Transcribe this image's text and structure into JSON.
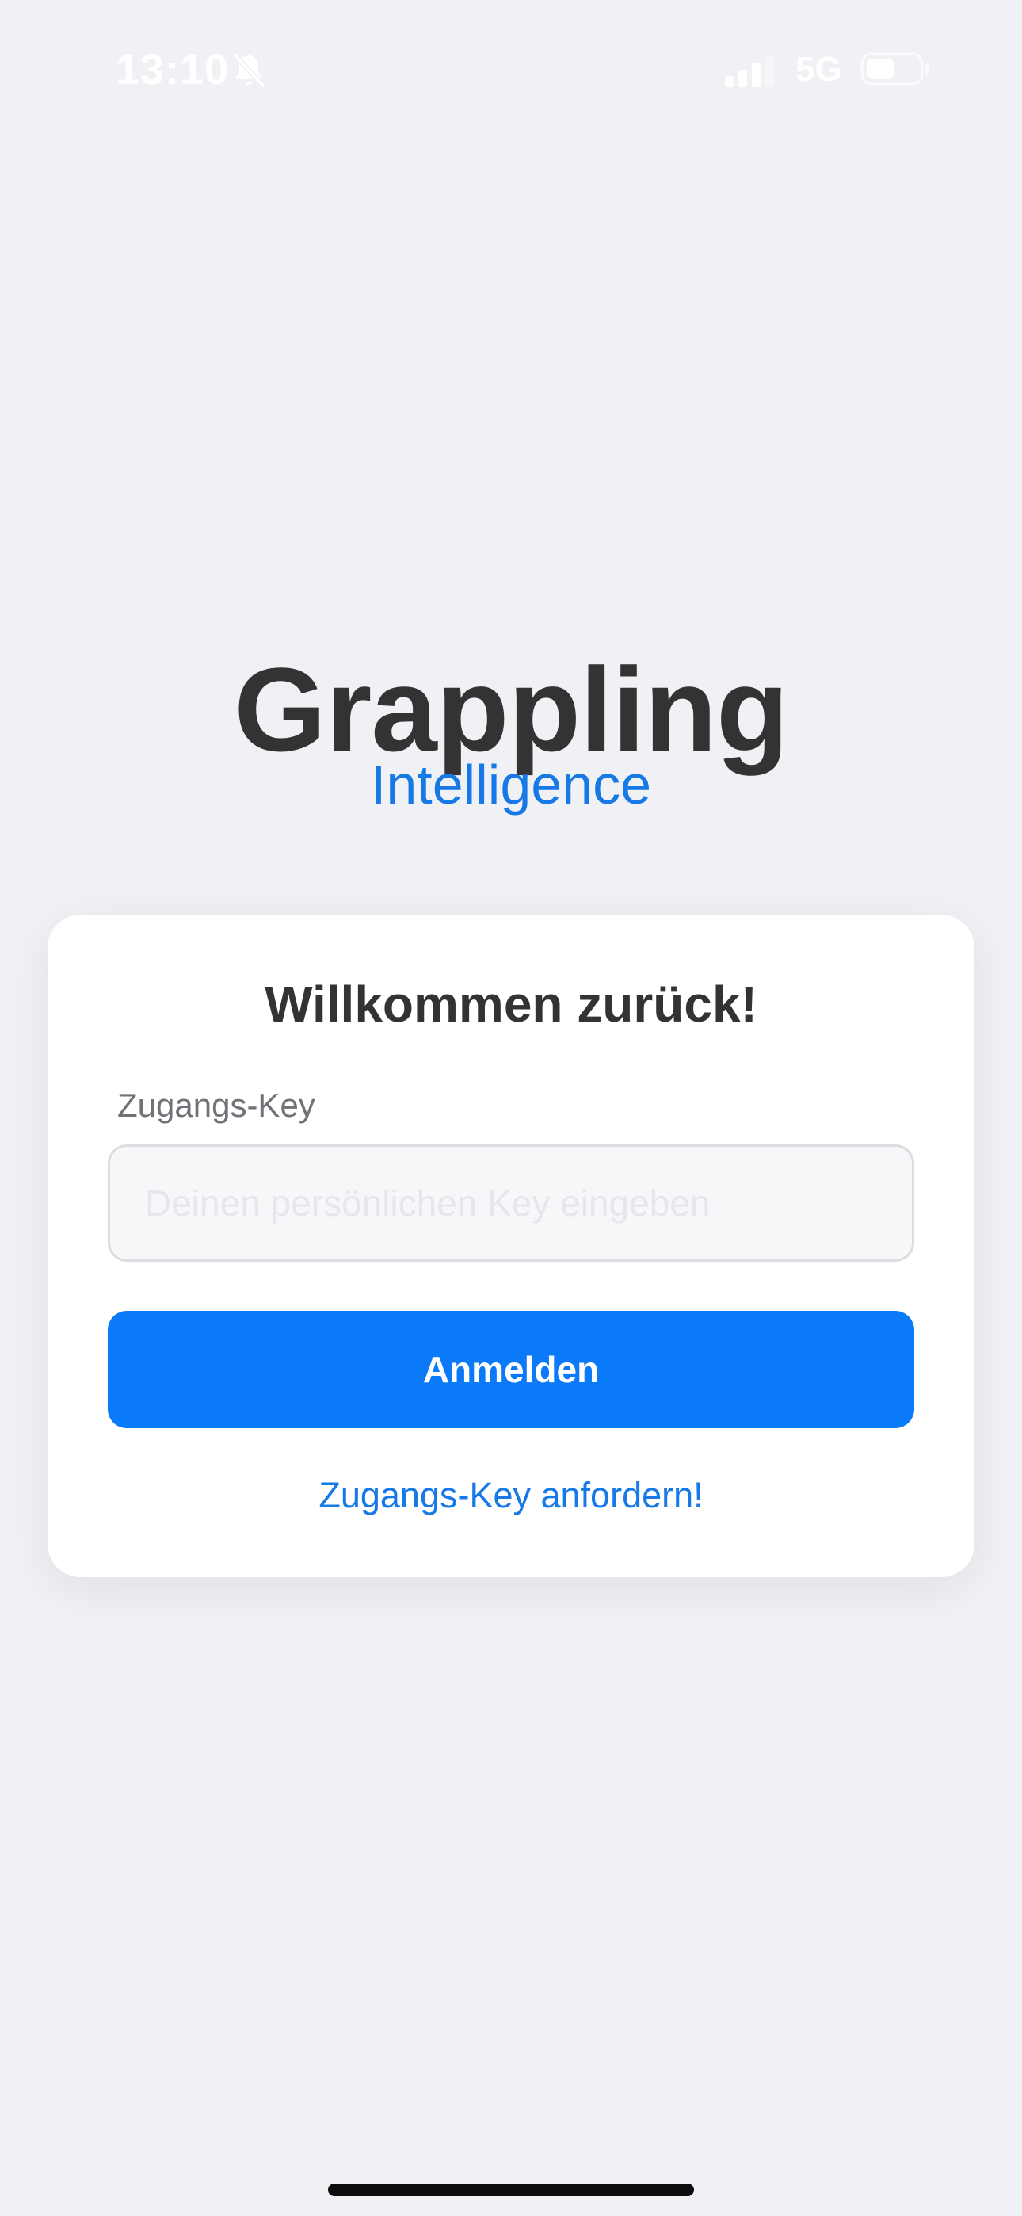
{
  "status_bar": {
    "time": "13:10",
    "network": "5G",
    "icons": {
      "silent_mode": "bell-slash-icon",
      "signal": "cellular-signal-icon",
      "battery": "battery-icon"
    }
  },
  "brand": {
    "title": "Grappling",
    "subtitle": "Intelligence"
  },
  "login_card": {
    "heading": "Willkommen zurück!",
    "key_label": "Zugangs-Key",
    "key_input": {
      "value": "",
      "placeholder": "Deinen persönlichen Key eingeben"
    },
    "submit_label": "Anmelden",
    "request_key_link": "Zugangs-Key anfordern!"
  },
  "colors": {
    "background": "#f0f1f5",
    "primary": "#0a7af8",
    "link": "#1679e6",
    "text_dark": "#333333",
    "text_muted": "#6f7378"
  }
}
